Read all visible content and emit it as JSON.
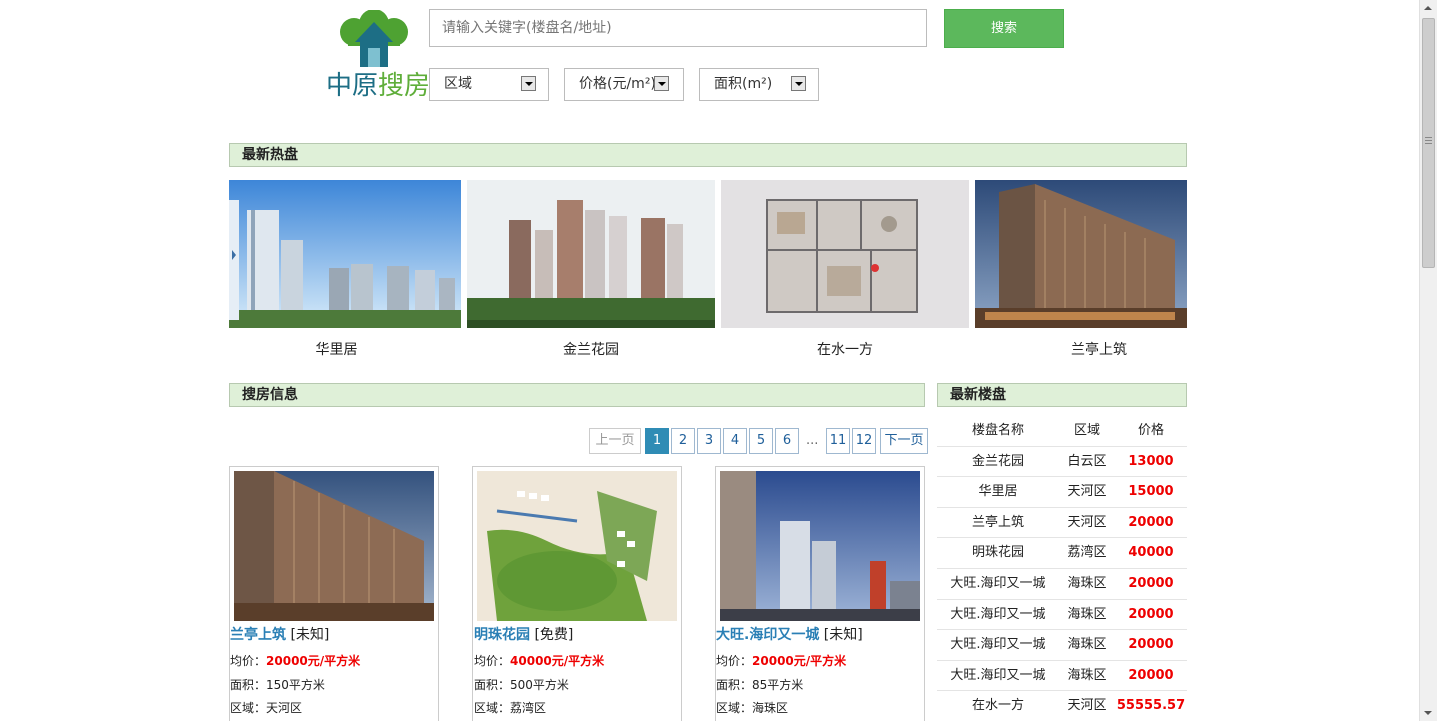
{
  "logo": {
    "part1": "中原",
    "part2": "搜房"
  },
  "search": {
    "placeholder": "请输入关键字(楼盘名/地址)",
    "button_label": "搜索"
  },
  "filters": [
    {
      "label": "区域"
    },
    {
      "label": "价格(元/m²)"
    },
    {
      "label": "面积(m²)"
    }
  ],
  "hot_section": {
    "title": "最新热盘",
    "items": [
      {
        "name": "华里居",
        "image": "residential-towers-photo"
      },
      {
        "name": "金兰花园",
        "image": "residential-towers-photo"
      },
      {
        "name": "在水一方",
        "image": "floor-plan-drawing"
      },
      {
        "name": "兰亭上筑",
        "image": "building-dusk-photo"
      }
    ]
  },
  "search_info": {
    "title": "搜房信息",
    "pager": {
      "prev": "上一页",
      "pages": [
        "1",
        "2",
        "3",
        "4",
        "5",
        "6"
      ],
      "dots": "...",
      "last_pages": [
        "11",
        "12"
      ],
      "next": "下一页",
      "active": "1"
    },
    "listings": [
      {
        "name": "兰亭上筑",
        "tag": "[未知]",
        "price_label": "均价：",
        "price": "20000元/平方米",
        "area_label": "面积：",
        "area": "150平方米",
        "district_label": "区域：",
        "district": "天河区"
      },
      {
        "name": "明珠花园",
        "tag": "[免费]",
        "price_label": "均价：",
        "price": "40000元/平方米",
        "area_label": "面积：",
        "area": "500平方米",
        "district_label": "区域：",
        "district": "荔湾区"
      },
      {
        "name": "大旺.海印又一城",
        "tag": "[未知]",
        "price_label": "均价：",
        "price": "20000元/平方米",
        "area_label": "面积：",
        "area": "85平方米",
        "district_label": "区域：",
        "district": "海珠区"
      }
    ]
  },
  "latest": {
    "title": "最新楼盘",
    "headers": [
      "楼盘名称",
      "区域",
      "价格"
    ],
    "rows": [
      {
        "name": "金兰花园",
        "district": "白云区",
        "price": "13000"
      },
      {
        "name": "华里居",
        "district": "天河区",
        "price": "15000"
      },
      {
        "name": "兰亭上筑",
        "district": "天河区",
        "price": "20000"
      },
      {
        "name": "明珠花园",
        "district": "荔湾区",
        "price": "40000"
      },
      {
        "name": "大旺.海印又一城",
        "district": "海珠区",
        "price": "20000"
      },
      {
        "name": "大旺.海印又一城",
        "district": "海珠区",
        "price": "20000"
      },
      {
        "name": "大旺.海印又一城",
        "district": "海珠区",
        "price": "20000"
      },
      {
        "name": "大旺.海印又一城",
        "district": "海珠区",
        "price": "20000"
      },
      {
        "name": "在水一方",
        "district": "天河区",
        "price": "55555.57"
      }
    ]
  },
  "colors": {
    "accent_green": "#5cb85c",
    "section_bg": "#dff0d8",
    "price_red": "#ee0000",
    "link_blue": "#2a7fb5"
  }
}
